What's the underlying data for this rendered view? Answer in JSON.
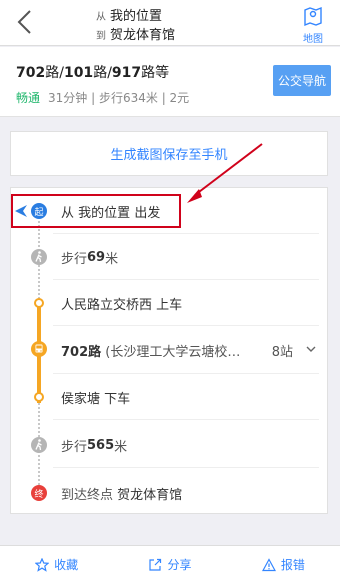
{
  "header": {
    "from_prefix": "从",
    "from_place": "我的位置",
    "to_prefix": "到",
    "to_place": "贺龙体育馆",
    "map_label": "地图"
  },
  "summary": {
    "routes": [
      {
        "num": "702",
        "suffix": "路",
        "sep": "/"
      },
      {
        "num": "101",
        "suffix": "路",
        "sep": "/"
      },
      {
        "num": "917",
        "suffix": "路等",
        "sep": ""
      }
    ],
    "status": "畅通",
    "duration": "31分钟",
    "walk": "步行634米",
    "price": "2元",
    "nav_label": "公交导航"
  },
  "screenshot_label": "生成截图保存至手机",
  "steps": {
    "start": {
      "badge": "起",
      "prefix": "从",
      "place": "我的位置",
      "suffix": "出发"
    },
    "walk1": {
      "prefix": "步行",
      "distance": "69",
      "unit": "米"
    },
    "board": {
      "station": "人民路立交桥西",
      "action": "上车"
    },
    "bus": {
      "route": "702路",
      "direction": "(长沙理工大学云塘校…",
      "stops": "8站"
    },
    "alight": {
      "station": "侯家塘",
      "action": "下车"
    },
    "walk2": {
      "prefix": "步行",
      "distance": "565",
      "unit": "米"
    },
    "end": {
      "badge": "终",
      "prefix": "到达终点",
      "place": "贺龙体育馆"
    }
  },
  "bottom": {
    "favorite": "收藏",
    "share": "分享",
    "report": "报错"
  },
  "colors": {
    "accent": "#3385ff",
    "status_green": "#21b76d",
    "bus_line": "#f5a623",
    "highlight": "#d0021b"
  }
}
